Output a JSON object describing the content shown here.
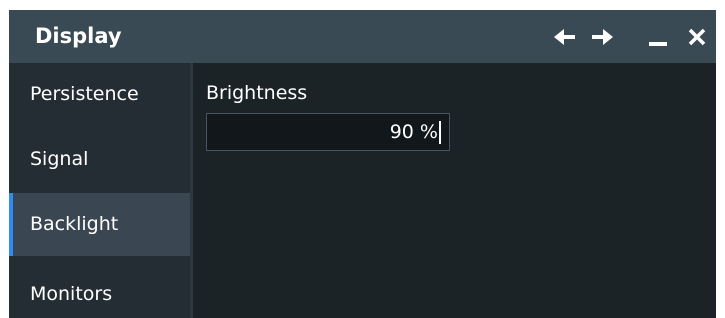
{
  "window": {
    "title": "Display"
  },
  "titlebar": {
    "buttons": [
      {
        "name": "back",
        "icon": "arrow-left-icon"
      },
      {
        "name": "forward",
        "icon": "arrow-right-icon"
      },
      {
        "name": "minimize",
        "icon": "minimize-icon"
      },
      {
        "name": "close",
        "icon": "close-icon"
      }
    ]
  },
  "sidebar": {
    "items": [
      {
        "label": "Persistence",
        "active": false
      },
      {
        "label": "Signal",
        "active": false
      },
      {
        "label": "Backlight",
        "active": true
      },
      {
        "label": "Monitors",
        "active": false
      }
    ]
  },
  "main": {
    "brightness": {
      "label": "Brightness",
      "value": "90 %"
    }
  },
  "colors": {
    "titlebar": "#3a4a54",
    "background": "#1c2327",
    "sidebar": "#242d33",
    "active_item": "#3a4752",
    "accent": "#2b8ef0",
    "text": "#ffffff"
  }
}
